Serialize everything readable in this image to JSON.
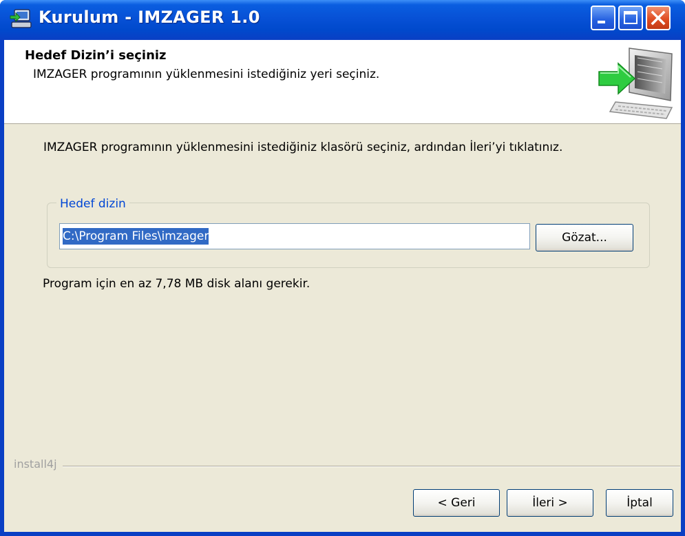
{
  "window": {
    "title": "Kurulum - IMZAGER 1.0",
    "icons": {
      "app": "installer-computer-icon",
      "minimize": "minimize-icon",
      "maximize": "maximize-icon",
      "close": "close-icon"
    }
  },
  "header": {
    "title": "Hedef Dizin’i seçiniz",
    "subtitle": "IMZAGER programının yüklenmesini istediğiniz yeri seçiniz.",
    "graphic": "computer-with-green-arrow-icon"
  },
  "body": {
    "instruction": "IMZAGER programının yüklenmesini istediğiniz klasörü seçiniz, ardından İleri’yi tıklatınız.",
    "destination_group": {
      "legend": "Hedef dizin",
      "path_value": "C:\\Program Files\\imzager",
      "browse_label": "Gözat..."
    },
    "disk_note": "Program için en az 7,78 MB disk alanı gerekir."
  },
  "footer": {
    "brand": "install4j",
    "back_label": "< Geri",
    "next_label": "İleri >",
    "cancel_label": "İptal"
  },
  "colors": {
    "titlebar": "#0a5ee0",
    "dialog_bg": "#ece9d8",
    "selection": "#316ac5",
    "legend_text": "#0046d5"
  }
}
